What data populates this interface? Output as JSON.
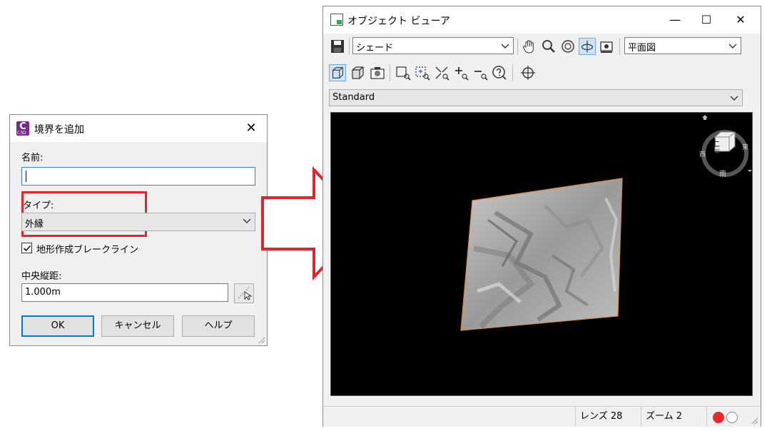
{
  "dialog": {
    "title": "境界を追加",
    "app_icon_letter": "C",
    "app_icon_sub": "C3D",
    "close_glyph": "✕",
    "name_label": "名前:",
    "name_value": "",
    "type_label": "タイプ:",
    "type_value": "外縁",
    "checkbox_label": "地形作成ブレークライン",
    "checkbox_checked": true,
    "mid_ordinate_label": "中央縦距:",
    "mid_ordinate_value": "1.000m",
    "ok_label": "OK",
    "cancel_label": "キャンセル",
    "help_label": "ヘルプ",
    "highlight_color": "#e0262d"
  },
  "viewer": {
    "title": "オブジェクト ビューア",
    "minimize_glyph": "—",
    "maximize_glyph": "☐",
    "close_glyph": "✕",
    "visual_style": "シェード",
    "view_direction": "平面図",
    "view_preset": "Standard",
    "viewcube": {
      "top": "上",
      "west": "西",
      "east": "東",
      "south": "南",
      "front": "前"
    },
    "status": {
      "lens": "レンズ 28",
      "zoom": "ズーム 2"
    },
    "status_dot_color": "#e8262b",
    "icons": [
      "save-icon",
      "pan-icon",
      "zoom-icon",
      "orbit-icon",
      "free-orbit-icon",
      "camera-icon",
      "cube-wire-icon",
      "shaded-box-icon",
      "camera-view-icon",
      "zoom-window-icon",
      "zoom-object-icon",
      "zoom-extents-icon",
      "zoom-in-icon",
      "zoom-out-icon",
      "help-icon",
      "center-icon"
    ]
  }
}
